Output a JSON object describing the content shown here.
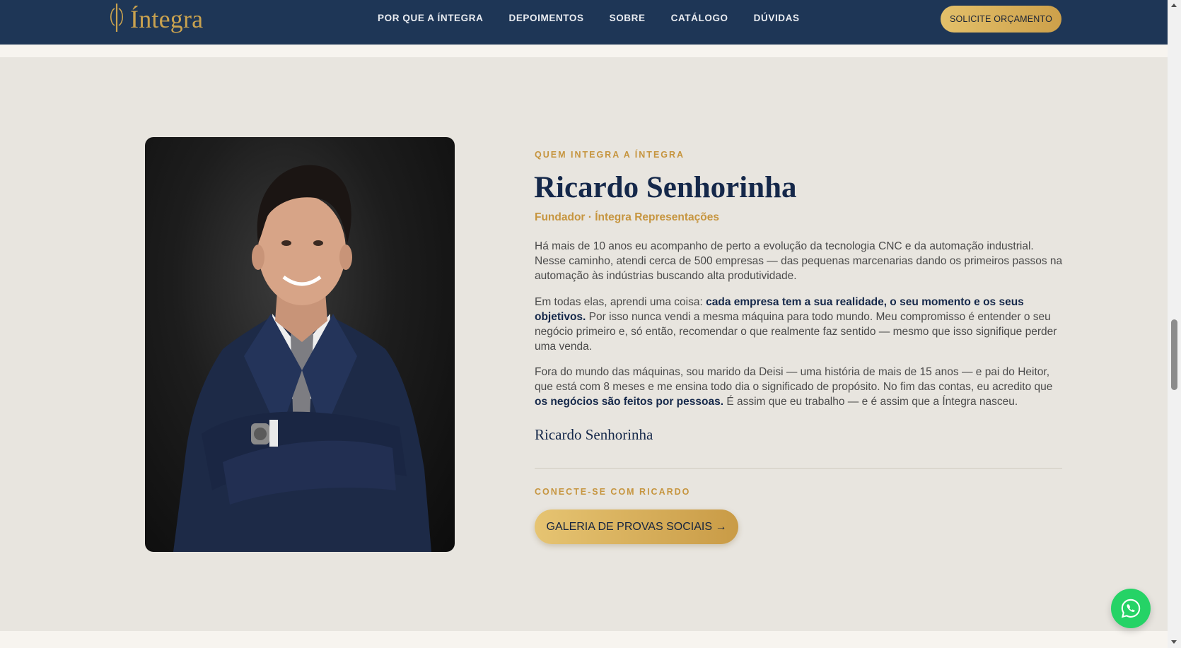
{
  "header": {
    "logo_text": "Íntegra",
    "nav": [
      {
        "label": "POR QUE A ÍNTEGRA"
      },
      {
        "label": "DEPOIMENTOS"
      },
      {
        "label": "SOBRE"
      },
      {
        "label": "CATÁLOGO"
      },
      {
        "label": "DÚVIDAS"
      }
    ],
    "cta_label": "SOLICITE ORÇAMENTO"
  },
  "about": {
    "eyebrow": "QUEM INTEGRA A ÍNTEGRA",
    "name": "Ricardo Senhorinha",
    "role": "Fundador · Íntegra Representações",
    "p1": "Há mais de 10 anos eu acompanho de perto a evolução da tecnologia CNC e da automação industrial. Nesse caminho, atendi cerca de 500 empresas — das pequenas marcenarias dando os primeiros passos na automação às indústrias buscando alta produtividade.",
    "p2_pre": "Em todas elas, aprendi uma coisa: ",
    "p2_bold": "cada empresa tem a sua realidade, o seu momento e os seus objetivos.",
    "p2_post": " Por isso nunca vendi a mesma máquina para todo mundo. Meu compromisso é entender o seu negócio primeiro e, só então, recomendar o que realmente faz sentido — mesmo que isso signifique perder uma venda.",
    "p3_pre": "Fora do mundo das máquinas, sou marido da Deisi — uma história de mais de 15 anos — e pai do Heitor, que está com 8 meses e me ensina todo dia o significado de propósito. No fim das contas, eu acredito que ",
    "p3_bold": "os negócios são feitos por pessoas.",
    "p3_post": " É assim que eu trabalho — e é assim que a Íntegra nasceu.",
    "signature": "Ricardo Senhorinha",
    "connect_eyebrow": "CONECTE-SE COM RICARDO",
    "cta_label": "GALERIA DE PROVAS SOCIAIS →"
  },
  "icons": {
    "whatsapp": "whatsapp-icon"
  },
  "colors": {
    "header_bg": "#1e3656",
    "gold": "#c6953f",
    "navy_text": "#15284a",
    "section_bg": "#e8e5df",
    "whatsapp_green": "#25d366"
  }
}
